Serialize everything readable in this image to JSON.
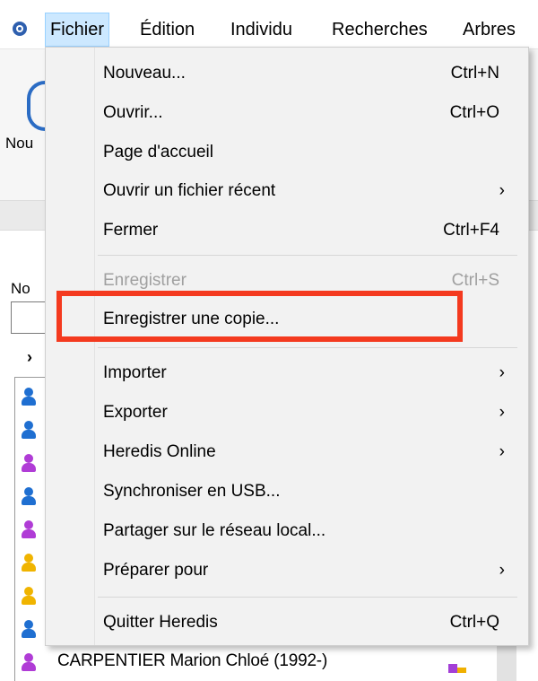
{
  "menubar": {
    "app_icon": "heredis-app-icon",
    "items": [
      {
        "label": "Fichier",
        "active": true
      },
      {
        "label": "Édition"
      },
      {
        "label": "Individu"
      },
      {
        "label": "Recherches"
      },
      {
        "label": "Arbres"
      }
    ]
  },
  "background": {
    "toolbar_button_label": "Nou",
    "name_label": "No",
    "last_row_text": "CARPENTIER Marion Chloé (1992-)",
    "person_icon_colors": [
      "#1f6fd1",
      "#1f6fd1",
      "#b03cd6",
      "#1f6fd1",
      "#b03cd6",
      "#f0b400",
      "#f0b400",
      "#1f6fd1",
      "#b03cd6"
    ]
  },
  "file_menu": {
    "items": [
      {
        "label": "Nouveau...",
        "shortcut": "Ctrl+N"
      },
      {
        "label": "Ouvrir...",
        "shortcut": "Ctrl+O"
      },
      {
        "label": "Page d'accueil",
        "shortcut": ""
      },
      {
        "label": "Ouvrir un fichier récent",
        "submenu": true
      },
      {
        "label": "Fermer",
        "shortcut": "Ctrl+F4"
      },
      {
        "label": "Enregistrer",
        "shortcut": "Ctrl+S",
        "disabled": true
      },
      {
        "label": "Enregistrer une copie...",
        "highlighted": true
      },
      {
        "label": "Importer",
        "submenu": true
      },
      {
        "label": "Exporter",
        "submenu": true
      },
      {
        "label": "Heredis Online",
        "submenu": true
      },
      {
        "label": "Synchroniser en USB..."
      },
      {
        "label": "Partager sur le réseau local..."
      },
      {
        "label": "Préparer pour",
        "submenu": true
      },
      {
        "label": "Quitter Heredis",
        "shortcut": "Ctrl+Q"
      }
    ],
    "submenu_glyph": "›",
    "highlight_color": "#f43a1f"
  }
}
